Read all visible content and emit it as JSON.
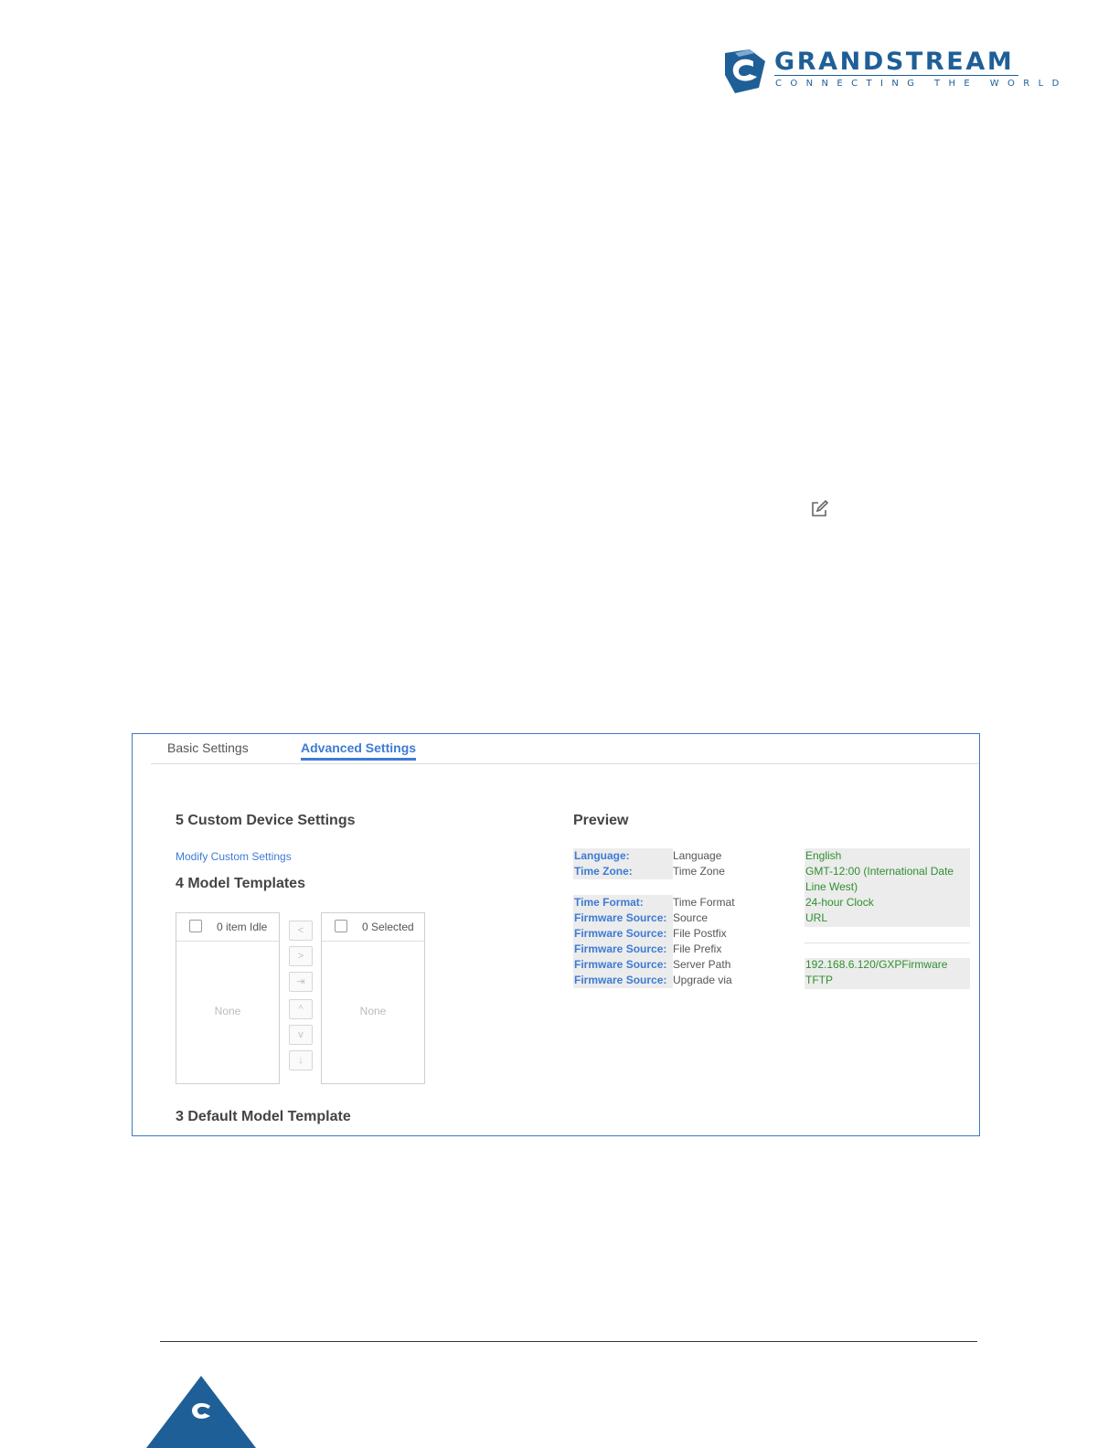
{
  "brand": {
    "name": "GRANDSTREAM",
    "tagline": "CONNECTING THE WORLD",
    "colors": {
      "primary": "#1f5f97",
      "accent": "#3e7bd4",
      "value": "#2f8f2f"
    }
  },
  "tabs": [
    {
      "label": "Basic Settings",
      "active": false
    },
    {
      "label": "Advanced Settings",
      "active": true
    }
  ],
  "left": {
    "custom_heading": "5 Custom Device Settings",
    "modify_link": "Modify Custom Settings",
    "templates_heading": "4 Model Templates",
    "idle_list": {
      "title": "0 item Idle",
      "empty": "None"
    },
    "selected_list": {
      "title": "0 Selected",
      "empty": "None"
    },
    "move_buttons": [
      "<",
      ">",
      "⇥",
      "^",
      "v",
      "↓"
    ],
    "default_heading": "3 Default Model Template"
  },
  "preview": {
    "heading": "Preview",
    "rows": [
      {
        "key": "Language:",
        "label": "Language"
      },
      {
        "key": "Time Zone:",
        "label": "Time Zone"
      },
      {
        "key": "Time Format:",
        "label": "Time Format"
      },
      {
        "key": "Firmware Source:",
        "label": "Source"
      },
      {
        "key": "Firmware Source:",
        "label": "File Postfix"
      },
      {
        "key": "Firmware Source:",
        "label": "File Prefix"
      },
      {
        "key": "Firmware Source:",
        "label": "Server Path"
      },
      {
        "key": "Firmware Source:",
        "label": "Upgrade via"
      }
    ],
    "values": {
      "language": "English",
      "timezone_1": "GMT-12:00 (International Date",
      "timezone_2": "Line West)",
      "time_format": "24-hour Clock",
      "source": "URL",
      "server_path": "192.168.6.120/GXPFirmware",
      "upgrade_via": "TFTP"
    }
  },
  "icons": {
    "edit": "edit-icon",
    "footer": "grandstream-mark-icon"
  }
}
